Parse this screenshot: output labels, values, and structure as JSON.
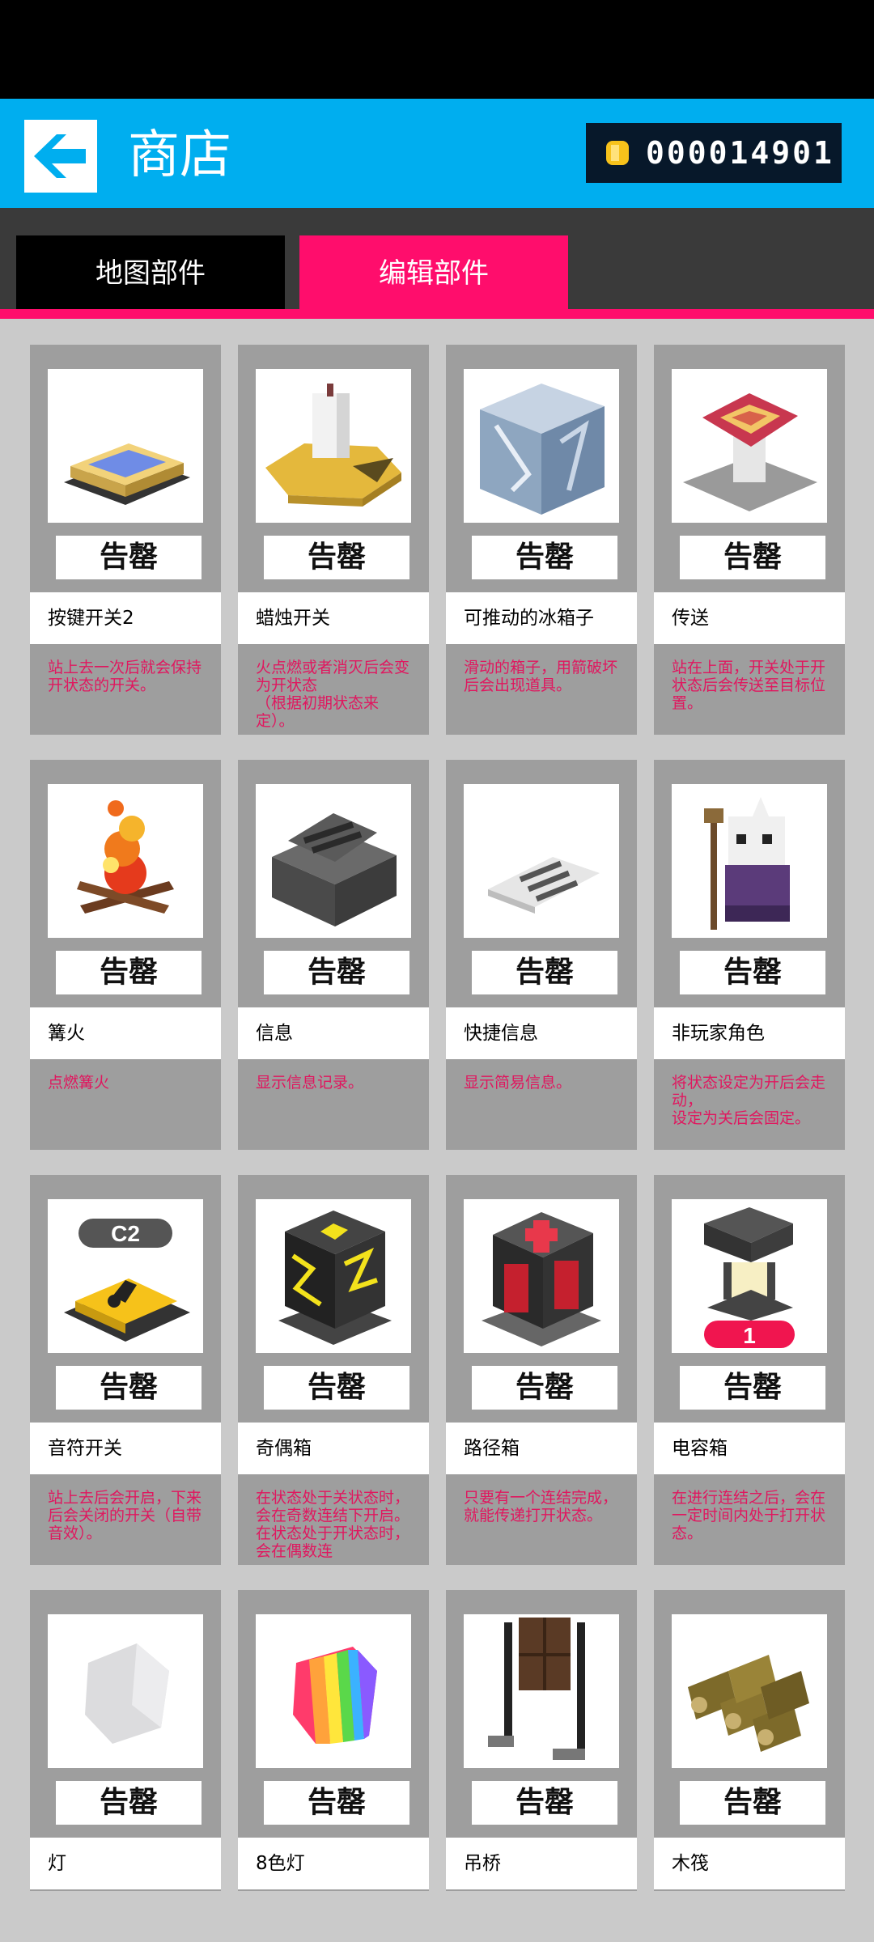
{
  "header": {
    "title": "商店",
    "coins": "000014901"
  },
  "tabs": {
    "map_parts": "地图部件",
    "edit_parts": "编辑部件"
  },
  "price_label": "告罄",
  "colors": {
    "header": "#00aeef",
    "accent": "#ff0d6c",
    "desc_text": "#e0175f"
  },
  "items": [
    {
      "name": "按键开关2",
      "desc": "站上去一次后就会保持开状态的开关。",
      "icon": "pressure-plate-icon"
    },
    {
      "name": "蜡烛开关",
      "desc": "火点燃或者消灭后会变为开状态\n（根据初期状态来定）。",
      "icon": "candle-switch-icon"
    },
    {
      "name": "可推动的冰箱子",
      "desc": "滑动的箱子，用箭破坏后会出现道具。",
      "icon": "ice-box-icon"
    },
    {
      "name": "传送",
      "desc": "站在上面，开关处于开状态后会传送至目标位置。",
      "icon": "teleporter-icon"
    },
    {
      "name": "篝火",
      "desc": "点燃篝火",
      "icon": "bonfire-icon"
    },
    {
      "name": "信息",
      "desc": "显示信息记录。",
      "icon": "message-block-icon"
    },
    {
      "name": "快捷信息",
      "desc": "显示简易信息。",
      "icon": "quick-message-icon"
    },
    {
      "name": "非玩家角色",
      "desc": "将状态设定为开后会走动，\n设定为关后会固定。",
      "icon": "npc-icon"
    },
    {
      "name": "音符开关",
      "desc": "站上去后会开启，下来后会关闭的开关（自带音效）。",
      "icon": "note-switch-icon"
    },
    {
      "name": "奇偶箱",
      "desc": "在状态处于关状态时，会在奇数连结下开启。在状态处于开状态时，会在偶数连",
      "icon": "odd-even-box-icon"
    },
    {
      "name": "路径箱",
      "desc": "只要有一个连结完成，就能传递打开状态。",
      "icon": "path-box-icon"
    },
    {
      "name": "电容箱",
      "desc": "在进行连结之后，会在一定时间内处于打开状态。",
      "icon": "capacitor-box-icon"
    },
    {
      "name": "灯",
      "desc": "",
      "icon": "lamp-icon"
    },
    {
      "name": "8色灯",
      "desc": "",
      "icon": "rainbow-lamp-icon"
    },
    {
      "name": "吊桥",
      "desc": "",
      "icon": "drawbridge-icon"
    },
    {
      "name": "木筏",
      "desc": "",
      "icon": "raft-icon"
    }
  ],
  "badges": {
    "note_switch": "C2",
    "capacitor": "1"
  }
}
